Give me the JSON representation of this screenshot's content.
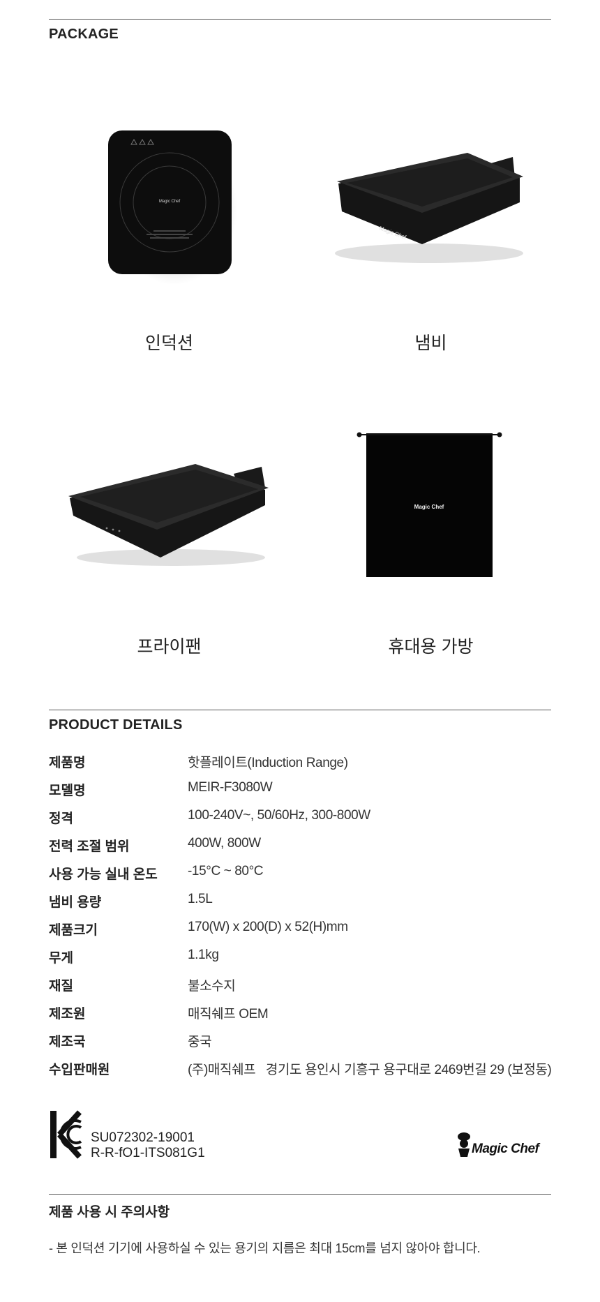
{
  "package": {
    "title": "PACKAGE",
    "items": [
      {
        "caption": "인덕션",
        "icon": "induction-cooktop-image",
        "logo_text": "Magic Chef"
      },
      {
        "caption": "냄비",
        "icon": "pot-image",
        "logo_text": "Magic Chef"
      },
      {
        "caption": "프라이팬",
        "icon": "frying-pan-image"
      },
      {
        "caption": "휴대용 가방",
        "icon": "carry-bag-image",
        "logo_text": "Magic Chef"
      }
    ]
  },
  "details": {
    "title": "PRODUCT DETAILS",
    "rows": [
      {
        "label": "제품명",
        "value": "핫플레이트(Induction Range)"
      },
      {
        "label": "모델명",
        "value": "MEIR-F3080W"
      },
      {
        "label": "정격",
        "value": "100-240V~, 50/60Hz, 300-800W"
      },
      {
        "label": "전력 조절 범위",
        "value": "400W, 800W"
      },
      {
        "label": "사용 가능 실내 온도",
        "value": "-15°C ~ 80°C"
      },
      {
        "label": "냄비 용량",
        "value": "1.5L"
      },
      {
        "label": "제품크기",
        "value": "170(W) x 200(D) x 52(H)mm"
      },
      {
        "label": "무게",
        "value": "1.1kg"
      },
      {
        "label": "재질",
        "value": "불소수지"
      },
      {
        "label": "제조원",
        "value": "매직쉐프 OEM"
      },
      {
        "label": "제조국",
        "value": "중국"
      },
      {
        "label": "수입판매원",
        "value": "(주)매직쉐프   경기도 용인시 기흥구 용구대로 2469번길 29 (보정동)"
      }
    ]
  },
  "certification": {
    "codes": [
      "SU072302-19001",
      "R-R-fO1-ITS081G1"
    ],
    "brand_logo_text": "Magic Chef"
  },
  "notice": {
    "title": "제품 사용 시 주의사항",
    "text": "- 본 인덕션 기기에 사용하실 수 있는 용기의 지름은 최대 15cm를 넘지 않아야 합니다."
  },
  "colors": {
    "rule": "#555555",
    "product_black": "#111111",
    "text": "#222222"
  }
}
